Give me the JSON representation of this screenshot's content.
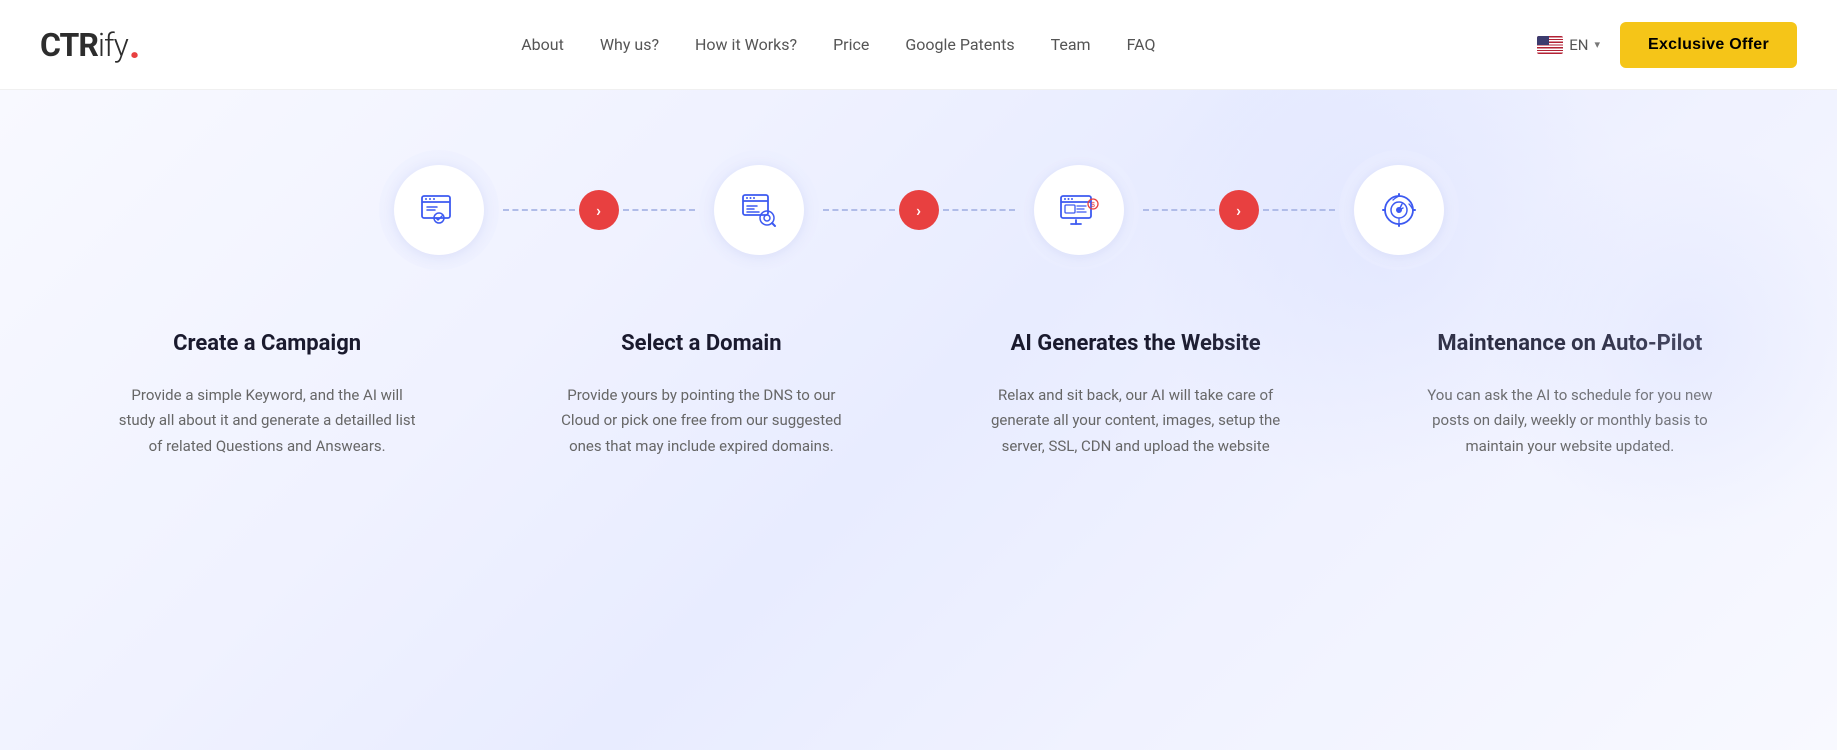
{
  "logo": {
    "ctr": "CTR",
    "ify": "ify",
    "dot": "."
  },
  "nav": {
    "links": [
      {
        "label": "About",
        "href": "#"
      },
      {
        "label": "Why us?",
        "href": "#"
      },
      {
        "label": "How it Works?",
        "href": "#"
      },
      {
        "label": "Price",
        "href": "#"
      },
      {
        "label": "Google Patents",
        "href": "#"
      },
      {
        "label": "Team",
        "href": "#"
      },
      {
        "label": "FAQ",
        "href": "#"
      }
    ],
    "lang": "EN",
    "exclusive_offer": "Exclusive Offer"
  },
  "steps": [
    {
      "id": "create-campaign",
      "title": "Create a Campaign",
      "description": "Provide a simple Keyword, and the AI will study all about it and generate a detailled list of related Questions and Answears."
    },
    {
      "id": "select-domain",
      "title": "Select a Domain",
      "description": "Provide yours by pointing the DNS to our Cloud or pick one free from our suggested ones that may include expired domains."
    },
    {
      "id": "ai-generates",
      "title": "AI Generates the Website",
      "description": "Relax and sit back, our AI will take care of generate all your content, images, setup the server, SSL, CDN and upload the website"
    },
    {
      "id": "maintenance",
      "title": "Maintenance on Auto-Pilot",
      "description": "You can ask the AI to schedule for you new posts on daily, weekly or monthly basis to maintain your website updated."
    }
  ],
  "arrows": {
    "label": "›"
  }
}
